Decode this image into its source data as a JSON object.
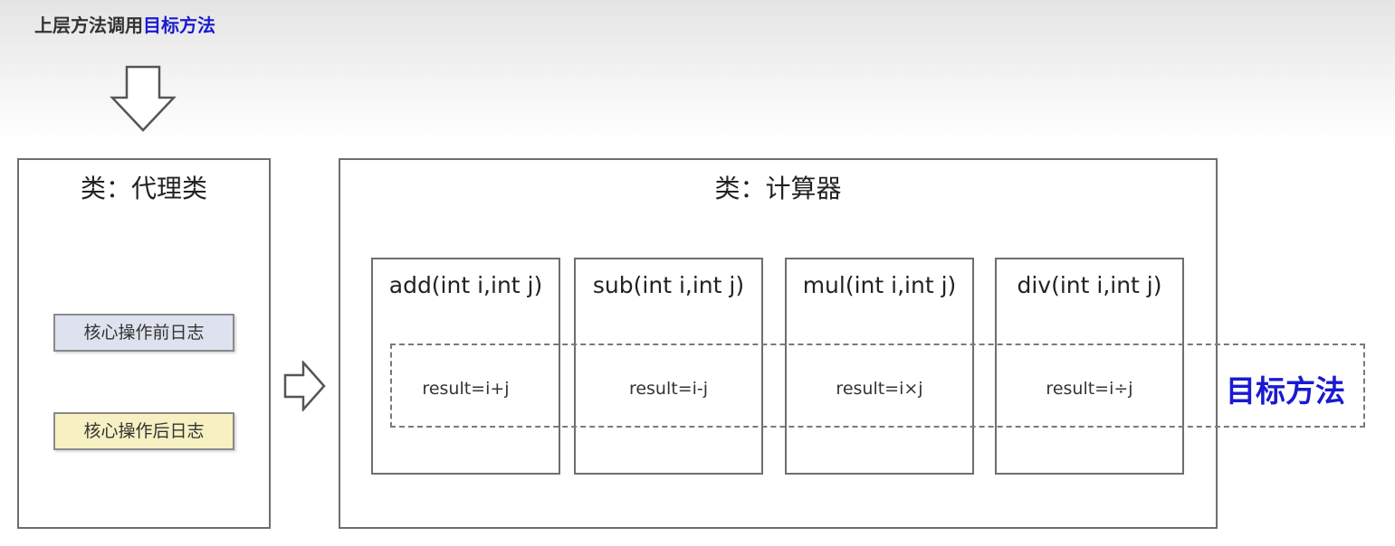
{
  "header": {
    "caller_text": "上层方法调用",
    "caller_highlight": "目标方法"
  },
  "proxy_class": {
    "title": "类：代理类",
    "log_before": "核心操作前日志",
    "log_after": "核心操作后日志"
  },
  "calculator_class": {
    "title": "类：计算器",
    "methods": [
      {
        "signature": "add(int i,int j)",
        "result": "result=i+j"
      },
      {
        "signature": "sub(int i,int j)",
        "result": "result=i-j"
      },
      {
        "signature": "mul(int i,int j)",
        "result": "result=i×j"
      },
      {
        "signature": "div(int i,int j)",
        "result": "result=i÷j"
      }
    ]
  },
  "target_method_label": "目标方法",
  "colors": {
    "highlight": "#1a1ad0",
    "log_before_bg": "#dee2ef",
    "log_after_bg": "#f6f0c2",
    "border": "#6e6e6e"
  },
  "icons": {
    "down_arrow": "down-arrow-icon",
    "right_arrow": "right-arrow-icon"
  }
}
